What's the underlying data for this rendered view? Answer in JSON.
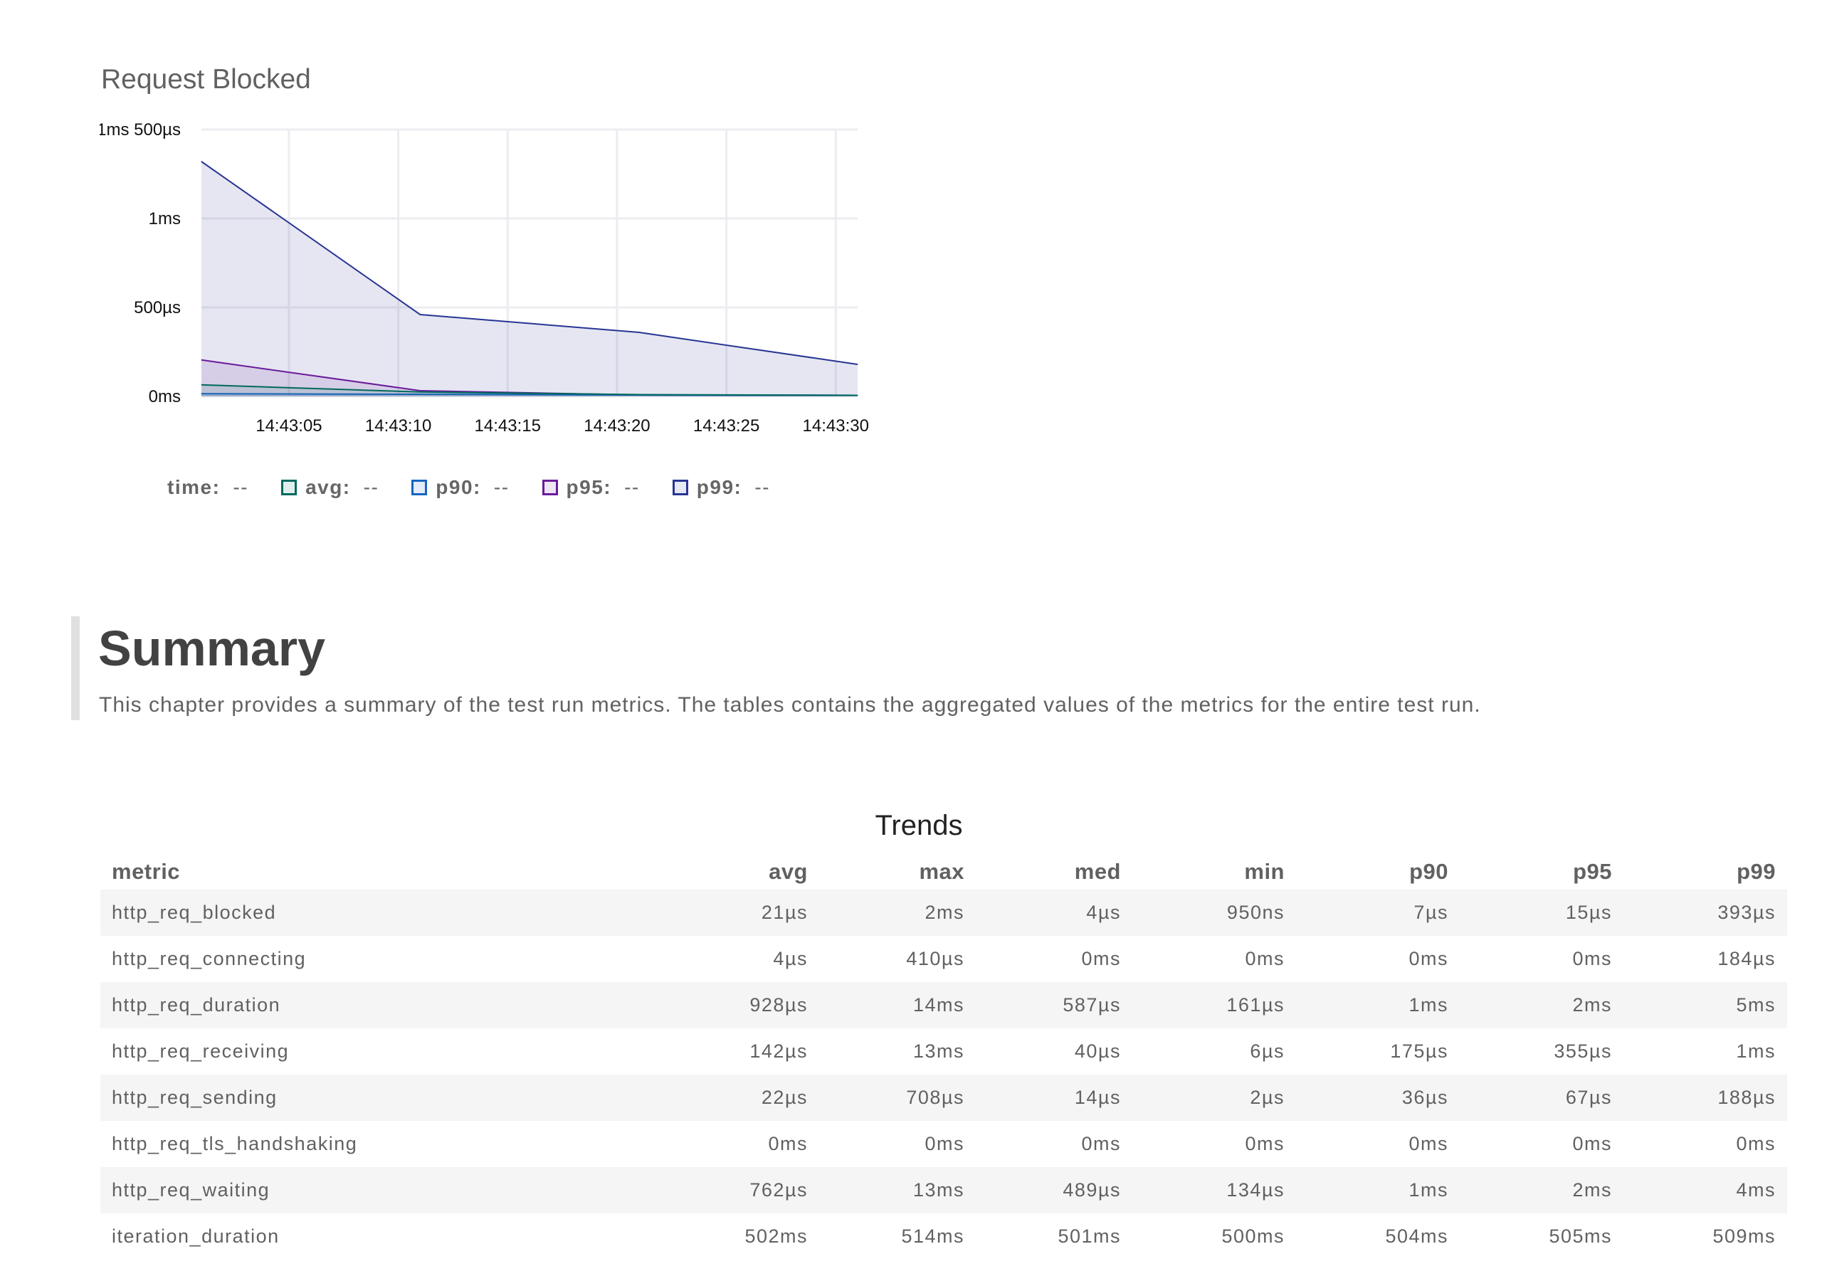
{
  "panel": {
    "title": "Request Blocked",
    "legend": [
      {
        "label": "time:",
        "value": "--"
      },
      {
        "label": "avg:",
        "value": "--",
        "color": "#00695c"
      },
      {
        "label": "p90:",
        "value": "--",
        "color": "#1565c0"
      },
      {
        "label": "p95:",
        "value": "--",
        "color": "#6a1b9a"
      },
      {
        "label": "p99:",
        "value": "--",
        "color": "#283593"
      }
    ]
  },
  "chart_data": {
    "type": "area",
    "title": "Request Blocked",
    "x": [
      "14:43:01",
      "14:43:11",
      "14:43:21",
      "14:43:31"
    ],
    "x_ticks": [
      "14:43:05",
      "14:43:10",
      "14:43:15",
      "14:43:20",
      "14:43:25",
      "14:43:30"
    ],
    "y_ticks": [
      "0ms",
      "500µs",
      "1ms",
      "1ms 500µs"
    ],
    "y_unit": "µs",
    "ylim": [
      0,
      1500
    ],
    "grid": true,
    "series": [
      {
        "name": "p99",
        "color": "#283593",
        "values": [
          1320,
          460,
          360,
          180
        ]
      },
      {
        "name": "p95",
        "color": "#6a1b9a",
        "values": [
          205,
          32,
          8,
          6
        ]
      },
      {
        "name": "p90",
        "color": "#1565c0",
        "values": [
          15,
          12,
          8,
          6
        ]
      },
      {
        "name": "avg",
        "color": "#00695c",
        "values": [
          65,
          25,
          10,
          6
        ]
      }
    ]
  },
  "summary": {
    "title": "Summary",
    "description": "This chapter provides a summary of the test run metrics. The tables contains the aggregated values of the metrics for the entire test run."
  },
  "trends": {
    "caption": "Trends",
    "columns": [
      "metric",
      "avg",
      "max",
      "med",
      "min",
      "p90",
      "p95",
      "p99"
    ],
    "rows": [
      [
        "http_req_blocked",
        "21µs",
        "2ms",
        "4µs",
        "950ns",
        "7µs",
        "15µs",
        "393µs"
      ],
      [
        "http_req_connecting",
        "4µs",
        "410µs",
        "0ms",
        "0ms",
        "0ms",
        "0ms",
        "184µs"
      ],
      [
        "http_req_duration",
        "928µs",
        "14ms",
        "587µs",
        "161µs",
        "1ms",
        "2ms",
        "5ms"
      ],
      [
        "http_req_receiving",
        "142µs",
        "13ms",
        "40µs",
        "6µs",
        "175µs",
        "355µs",
        "1ms"
      ],
      [
        "http_req_sending",
        "22µs",
        "708µs",
        "14µs",
        "2µs",
        "36µs",
        "67µs",
        "188µs"
      ],
      [
        "http_req_tls_handshaking",
        "0ms",
        "0ms",
        "0ms",
        "0ms",
        "0ms",
        "0ms",
        "0ms"
      ],
      [
        "http_req_waiting",
        "762µs",
        "13ms",
        "489µs",
        "134µs",
        "1ms",
        "2ms",
        "4ms"
      ],
      [
        "iteration_duration",
        "502ms",
        "514ms",
        "501ms",
        "500ms",
        "504ms",
        "505ms",
        "509ms"
      ]
    ]
  }
}
